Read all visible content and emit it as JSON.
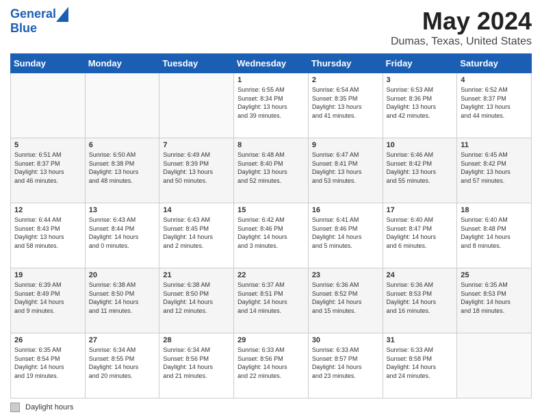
{
  "logo": {
    "line1": "General",
    "line2": "Blue"
  },
  "title": "May 2024",
  "subtitle": "Dumas, Texas, United States",
  "days_of_week": [
    "Sunday",
    "Monday",
    "Tuesday",
    "Wednesday",
    "Thursday",
    "Friday",
    "Saturday"
  ],
  "footer": {
    "legend_label": "Daylight hours"
  },
  "weeks": [
    [
      {
        "day": "",
        "info": ""
      },
      {
        "day": "",
        "info": ""
      },
      {
        "day": "",
        "info": ""
      },
      {
        "day": "1",
        "info": "Sunrise: 6:55 AM\nSunset: 8:34 PM\nDaylight: 13 hours\nand 39 minutes."
      },
      {
        "day": "2",
        "info": "Sunrise: 6:54 AM\nSunset: 8:35 PM\nDaylight: 13 hours\nand 41 minutes."
      },
      {
        "day": "3",
        "info": "Sunrise: 6:53 AM\nSunset: 8:36 PM\nDaylight: 13 hours\nand 42 minutes."
      },
      {
        "day": "4",
        "info": "Sunrise: 6:52 AM\nSunset: 8:37 PM\nDaylight: 13 hours\nand 44 minutes."
      }
    ],
    [
      {
        "day": "5",
        "info": "Sunrise: 6:51 AM\nSunset: 8:37 PM\nDaylight: 13 hours\nand 46 minutes."
      },
      {
        "day": "6",
        "info": "Sunrise: 6:50 AM\nSunset: 8:38 PM\nDaylight: 13 hours\nand 48 minutes."
      },
      {
        "day": "7",
        "info": "Sunrise: 6:49 AM\nSunset: 8:39 PM\nDaylight: 13 hours\nand 50 minutes."
      },
      {
        "day": "8",
        "info": "Sunrise: 6:48 AM\nSunset: 8:40 PM\nDaylight: 13 hours\nand 52 minutes."
      },
      {
        "day": "9",
        "info": "Sunrise: 6:47 AM\nSunset: 8:41 PM\nDaylight: 13 hours\nand 53 minutes."
      },
      {
        "day": "10",
        "info": "Sunrise: 6:46 AM\nSunset: 8:42 PM\nDaylight: 13 hours\nand 55 minutes."
      },
      {
        "day": "11",
        "info": "Sunrise: 6:45 AM\nSunset: 8:42 PM\nDaylight: 13 hours\nand 57 minutes."
      }
    ],
    [
      {
        "day": "12",
        "info": "Sunrise: 6:44 AM\nSunset: 8:43 PM\nDaylight: 13 hours\nand 58 minutes."
      },
      {
        "day": "13",
        "info": "Sunrise: 6:43 AM\nSunset: 8:44 PM\nDaylight: 14 hours\nand 0 minutes."
      },
      {
        "day": "14",
        "info": "Sunrise: 6:43 AM\nSunset: 8:45 PM\nDaylight: 14 hours\nand 2 minutes."
      },
      {
        "day": "15",
        "info": "Sunrise: 6:42 AM\nSunset: 8:46 PM\nDaylight: 14 hours\nand 3 minutes."
      },
      {
        "day": "16",
        "info": "Sunrise: 6:41 AM\nSunset: 8:46 PM\nDaylight: 14 hours\nand 5 minutes."
      },
      {
        "day": "17",
        "info": "Sunrise: 6:40 AM\nSunset: 8:47 PM\nDaylight: 14 hours\nand 6 minutes."
      },
      {
        "day": "18",
        "info": "Sunrise: 6:40 AM\nSunset: 8:48 PM\nDaylight: 14 hours\nand 8 minutes."
      }
    ],
    [
      {
        "day": "19",
        "info": "Sunrise: 6:39 AM\nSunset: 8:49 PM\nDaylight: 14 hours\nand 9 minutes."
      },
      {
        "day": "20",
        "info": "Sunrise: 6:38 AM\nSunset: 8:50 PM\nDaylight: 14 hours\nand 11 minutes."
      },
      {
        "day": "21",
        "info": "Sunrise: 6:38 AM\nSunset: 8:50 PM\nDaylight: 14 hours\nand 12 minutes."
      },
      {
        "day": "22",
        "info": "Sunrise: 6:37 AM\nSunset: 8:51 PM\nDaylight: 14 hours\nand 14 minutes."
      },
      {
        "day": "23",
        "info": "Sunrise: 6:36 AM\nSunset: 8:52 PM\nDaylight: 14 hours\nand 15 minutes."
      },
      {
        "day": "24",
        "info": "Sunrise: 6:36 AM\nSunset: 8:53 PM\nDaylight: 14 hours\nand 16 minutes."
      },
      {
        "day": "25",
        "info": "Sunrise: 6:35 AM\nSunset: 8:53 PM\nDaylight: 14 hours\nand 18 minutes."
      }
    ],
    [
      {
        "day": "26",
        "info": "Sunrise: 6:35 AM\nSunset: 8:54 PM\nDaylight: 14 hours\nand 19 minutes."
      },
      {
        "day": "27",
        "info": "Sunrise: 6:34 AM\nSunset: 8:55 PM\nDaylight: 14 hours\nand 20 minutes."
      },
      {
        "day": "28",
        "info": "Sunrise: 6:34 AM\nSunset: 8:56 PM\nDaylight: 14 hours\nand 21 minutes."
      },
      {
        "day": "29",
        "info": "Sunrise: 6:33 AM\nSunset: 8:56 PM\nDaylight: 14 hours\nand 22 minutes."
      },
      {
        "day": "30",
        "info": "Sunrise: 6:33 AM\nSunset: 8:57 PM\nDaylight: 14 hours\nand 23 minutes."
      },
      {
        "day": "31",
        "info": "Sunrise: 6:33 AM\nSunset: 8:58 PM\nDaylight: 14 hours\nand 24 minutes."
      },
      {
        "day": "",
        "info": ""
      }
    ]
  ]
}
